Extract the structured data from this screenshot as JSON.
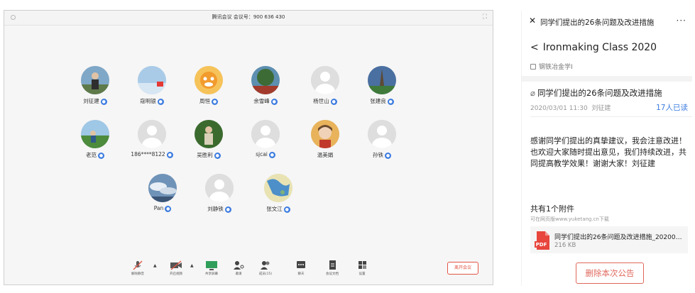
{
  "meeting": {
    "title": "腾讯会议 会议号：900 636 430",
    "participants": [
      {
        "name": "刘征建",
        "avatar": "photo-man-outdoors",
        "mic": true
      },
      {
        "name": "寇明银",
        "avatar": "photo-sky-flag",
        "mic": true
      },
      {
        "name": "周恒",
        "avatar": "cartoon-tiger",
        "mic": true
      },
      {
        "name": "余雪峰",
        "avatar": "photo-tree",
        "mic": true
      },
      {
        "name": "杨世山",
        "avatar": "default-person",
        "mic": true
      },
      {
        "name": "张建良",
        "avatar": "photo-tower",
        "mic": true
      },
      {
        "name": "老范",
        "avatar": "photo-field",
        "mic": true
      },
      {
        "name": "186****8122",
        "avatar": "default-person",
        "mic": true
      },
      {
        "name": "吴胜利",
        "avatar": "photo-man-tree",
        "mic": true
      },
      {
        "name": "sjcai",
        "avatar": "default-person",
        "mic": true
      },
      {
        "name": "温美娟",
        "avatar": "photo-woman",
        "mic": false
      },
      {
        "name": "孙铁",
        "avatar": "default-person",
        "mic": true
      },
      {
        "name": "Pan",
        "avatar": "photo-clouds",
        "mic": true
      },
      {
        "name": "刘静铁",
        "avatar": "default-person",
        "mic": true
      },
      {
        "name": "张文江",
        "avatar": "photo-map",
        "mic": true
      }
    ],
    "toolbar": {
      "mute": "解除静音",
      "video": "开启视频",
      "share": "共享屏幕",
      "invite": "邀请",
      "members": "成员(15)",
      "chat": "聊天",
      "docs": "会议文档",
      "settings": "设置",
      "leave": "离开会议"
    },
    "colors": {
      "accent": "#3c7ce0",
      "leave": "#e25545"
    }
  },
  "panel": {
    "nav_title": "同学们提出的26条问题及改进措施",
    "nav_more": "···",
    "course_title": "Ironmaking Class 2020",
    "course_sub": "钢铁冶金学I",
    "announcement": {
      "title": "同学们提出的26条问题及改进措施",
      "datetime": "2020/03/01 11:30",
      "author": "刘征建",
      "read_count": "17人已读",
      "body": "感谢同学们提出的真挚建议，我会注意改进！也欢迎大家随时提出意见，我们持续改进，共同提高教学效果！谢谢大家！刘征建"
    },
    "attachments": {
      "heading": "共有1个附件",
      "note": "可在网页版www.yuketang.cn下载",
      "file_name": "同学们提出的26条问题及改进措施_20200…",
      "file_type": "PDF",
      "file_size": "216 KB"
    },
    "delete_label": "删除本次公告",
    "colors": {
      "link": "#3c7ce0",
      "danger": "#e0675b"
    }
  }
}
